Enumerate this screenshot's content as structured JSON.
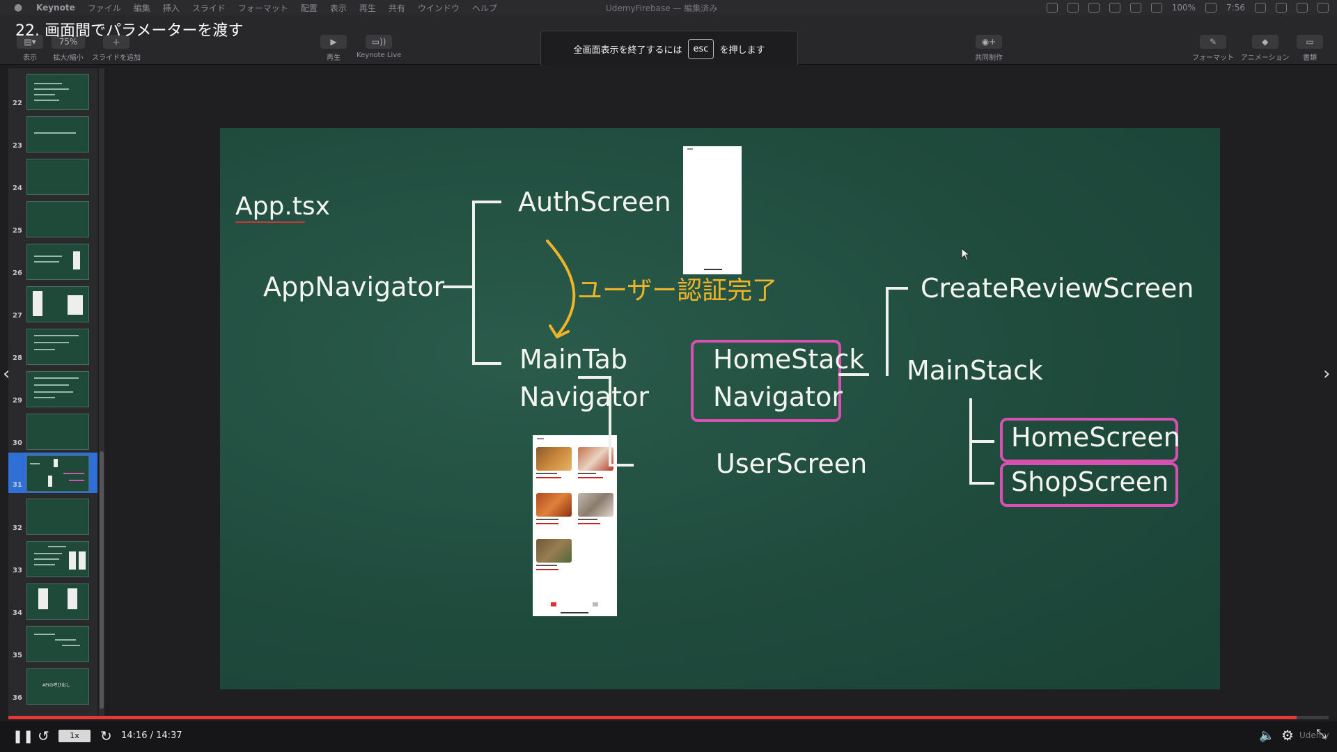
{
  "menubar": {
    "app_name": "Keynote",
    "items": [
      "ファイル",
      "編集",
      "挿入",
      "スライド",
      "フォーマット",
      "配置",
      "表示",
      "再生",
      "共有",
      "ウインドウ",
      "ヘルプ"
    ],
    "window_title": "UdemyFirebase — 編集済み",
    "battery": "100%",
    "time": "7:56"
  },
  "overlay_title": "22. 画面間でパラメーターを渡す",
  "toolbar": {
    "view_label": "表示",
    "zoom_value": "75%",
    "zoom_label": "拡大/縮小",
    "add_slide_label": "スライドを追加",
    "play_label": "再生",
    "keynote_live_label": "Keynote Live",
    "collaborate_label": "共同制作",
    "format_label": "フォーマット",
    "animate_label": "アニメーション",
    "document_label": "書類"
  },
  "esc_banner": {
    "before": "全画面表示を終了するには",
    "key": "esc",
    "after": "を押します"
  },
  "sidebar": {
    "slides": [
      "22",
      "23",
      "24",
      "25",
      "26",
      "27",
      "28",
      "29",
      "30",
      "31",
      "32",
      "33",
      "34",
      "35",
      "36"
    ],
    "active_slide": "31",
    "thumb_texts": {
      "36": "APIの呼び出し"
    }
  },
  "slide": {
    "app_tsx": "App.tsx",
    "app_navigator": "AppNavigator",
    "auth_screen": "AuthScreen",
    "auth_done": "ユーザー認証完了",
    "maintab_line1": "MainTab",
    "maintab_line2": "Navigator",
    "homestack_line1": "HomeStack",
    "homestack_line2": "Navigator",
    "user_screen": "UserScreen",
    "create_review_screen": "CreateReviewScreen",
    "main_stack": "MainStack",
    "home_screen": "HomeScreen",
    "shop_screen": "ShopScreen",
    "phone_items": [
      "鶏料ラーメン",
      "鉄板パスタ",
      "ピッツァ浜松町",
      "地面町カフェ",
      "ビストロ浜川"
    ],
    "ratings": [
      "4.83",
      "4.39",
      "5.0",
      "3.8",
      "2.86"
    ]
  },
  "player": {
    "time": "14:16 / 14:37",
    "progress": 0.976,
    "speed": "1x",
    "brand": "Udemy"
  },
  "colors": {
    "chalkboard": "#1f4b3d",
    "accent_pink": "#d94fb2",
    "accent_yellow": "#f0b429",
    "progress_red": "#e53935",
    "selection_blue": "#2f6fd6"
  }
}
